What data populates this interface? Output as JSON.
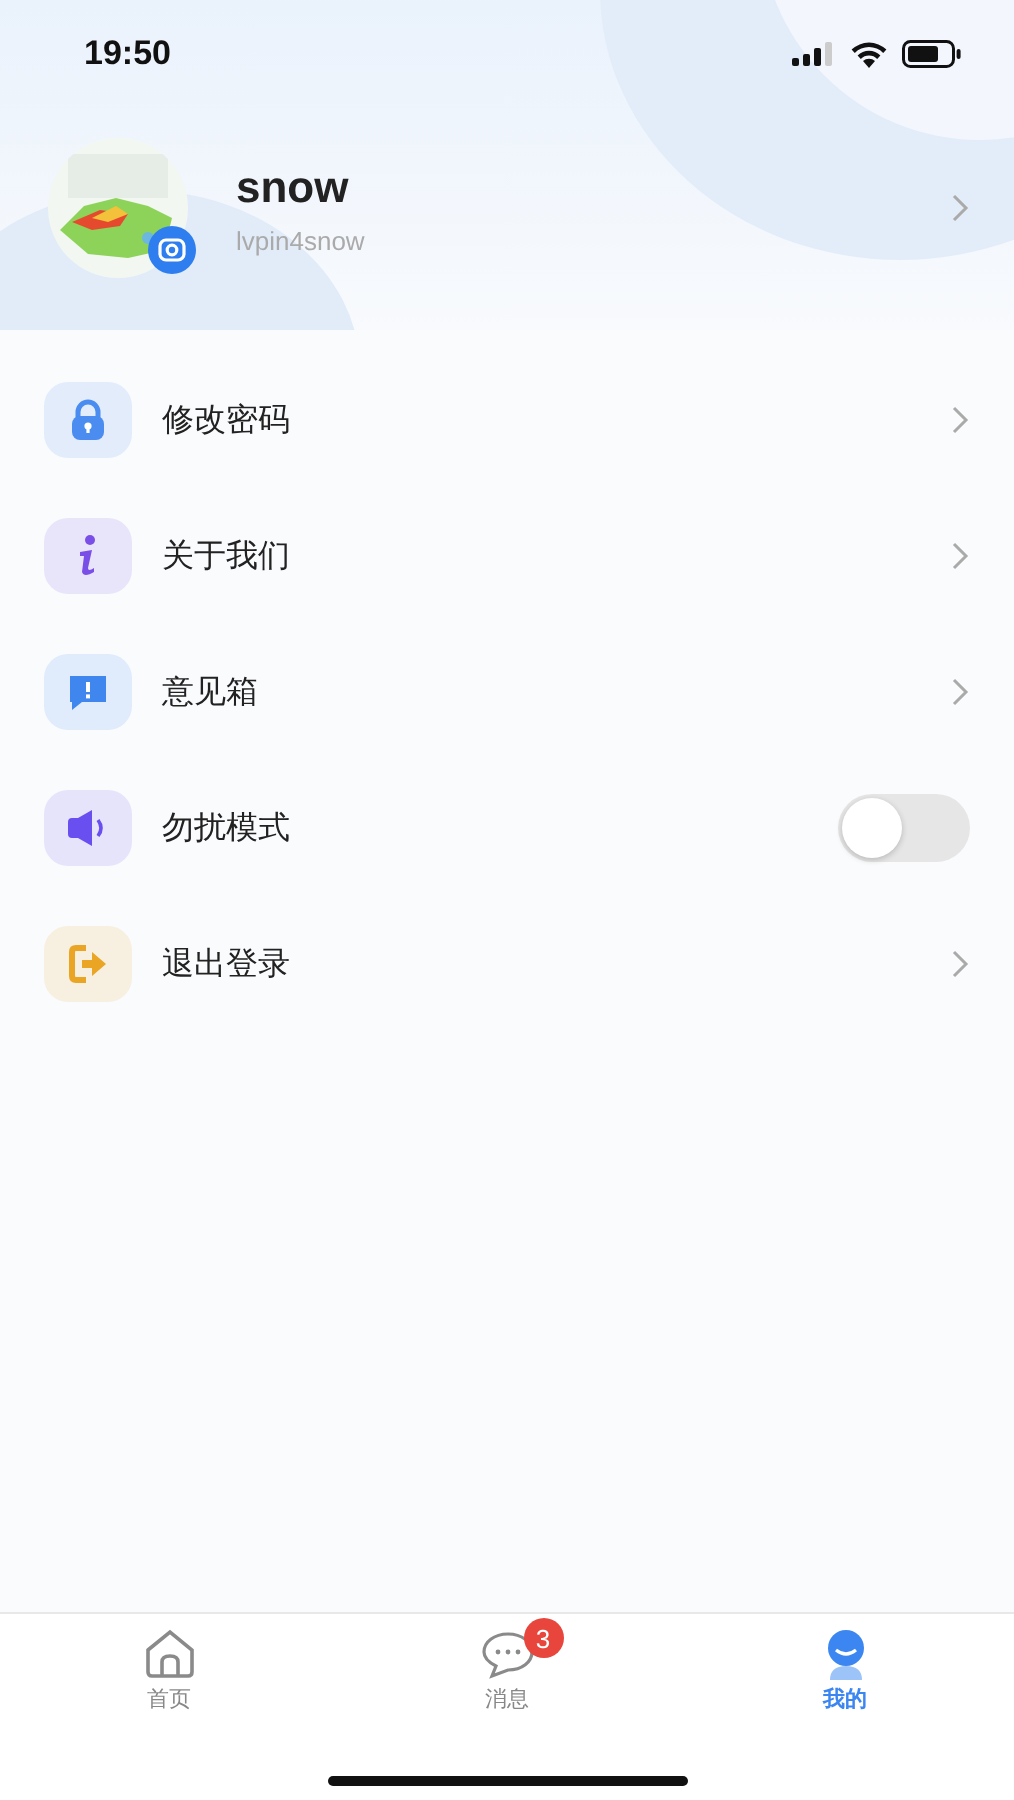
{
  "status_bar": {
    "time": "19:50"
  },
  "profile": {
    "name": "snow",
    "username": "lvpin4snow"
  },
  "menu": [
    {
      "kind": "link",
      "label": "修改密码",
      "color": "#4a8cf0"
    },
    {
      "kind": "link",
      "label": "关于我们",
      "color": "#7a4fe8"
    },
    {
      "kind": "link",
      "label": "意见箱",
      "color": "#3f86ee"
    },
    {
      "kind": "toggle",
      "label": "勿扰模式",
      "color": "#6a4ff0",
      "on": false
    },
    {
      "kind": "link",
      "label": "退出登录",
      "color": "#eaa524"
    }
  ],
  "tab_bar": [
    {
      "label": "首页",
      "selected": false
    },
    {
      "label": "消息",
      "selected": false,
      "badge": "3"
    },
    {
      "label": "我的",
      "selected": true
    }
  ]
}
